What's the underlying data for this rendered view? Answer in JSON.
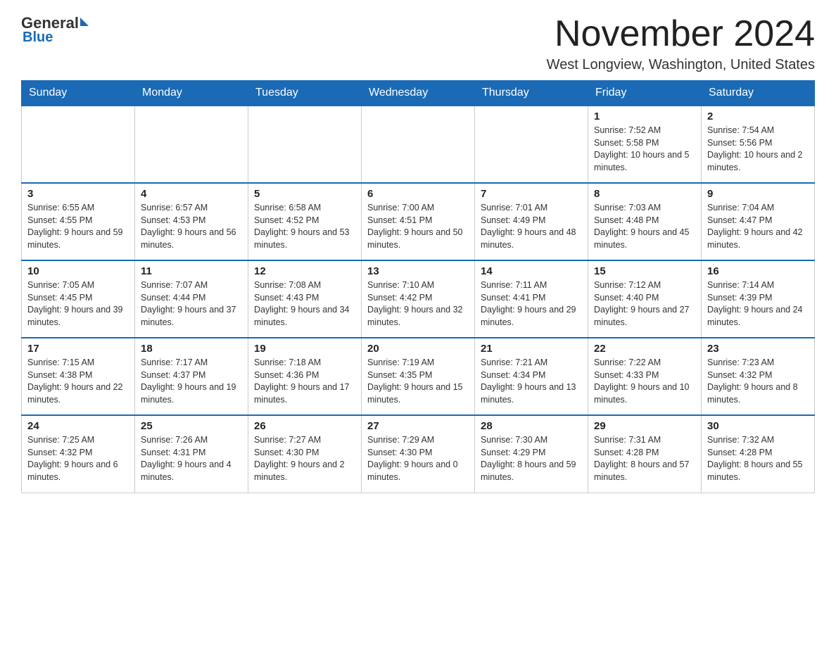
{
  "logo": {
    "general": "General",
    "blue": "Blue"
  },
  "title": {
    "month_year": "November 2024",
    "location": "West Longview, Washington, United States"
  },
  "weekdays": [
    "Sunday",
    "Monday",
    "Tuesday",
    "Wednesday",
    "Thursday",
    "Friday",
    "Saturday"
  ],
  "weeks": [
    [
      {
        "day": "",
        "info": ""
      },
      {
        "day": "",
        "info": ""
      },
      {
        "day": "",
        "info": ""
      },
      {
        "day": "",
        "info": ""
      },
      {
        "day": "",
        "info": ""
      },
      {
        "day": "1",
        "info": "Sunrise: 7:52 AM\nSunset: 5:58 PM\nDaylight: 10 hours and 5 minutes."
      },
      {
        "day": "2",
        "info": "Sunrise: 7:54 AM\nSunset: 5:56 PM\nDaylight: 10 hours and 2 minutes."
      }
    ],
    [
      {
        "day": "3",
        "info": "Sunrise: 6:55 AM\nSunset: 4:55 PM\nDaylight: 9 hours and 59 minutes."
      },
      {
        "day": "4",
        "info": "Sunrise: 6:57 AM\nSunset: 4:53 PM\nDaylight: 9 hours and 56 minutes."
      },
      {
        "day": "5",
        "info": "Sunrise: 6:58 AM\nSunset: 4:52 PM\nDaylight: 9 hours and 53 minutes."
      },
      {
        "day": "6",
        "info": "Sunrise: 7:00 AM\nSunset: 4:51 PM\nDaylight: 9 hours and 50 minutes."
      },
      {
        "day": "7",
        "info": "Sunrise: 7:01 AM\nSunset: 4:49 PM\nDaylight: 9 hours and 48 minutes."
      },
      {
        "day": "8",
        "info": "Sunrise: 7:03 AM\nSunset: 4:48 PM\nDaylight: 9 hours and 45 minutes."
      },
      {
        "day": "9",
        "info": "Sunrise: 7:04 AM\nSunset: 4:47 PM\nDaylight: 9 hours and 42 minutes."
      }
    ],
    [
      {
        "day": "10",
        "info": "Sunrise: 7:05 AM\nSunset: 4:45 PM\nDaylight: 9 hours and 39 minutes."
      },
      {
        "day": "11",
        "info": "Sunrise: 7:07 AM\nSunset: 4:44 PM\nDaylight: 9 hours and 37 minutes."
      },
      {
        "day": "12",
        "info": "Sunrise: 7:08 AM\nSunset: 4:43 PM\nDaylight: 9 hours and 34 minutes."
      },
      {
        "day": "13",
        "info": "Sunrise: 7:10 AM\nSunset: 4:42 PM\nDaylight: 9 hours and 32 minutes."
      },
      {
        "day": "14",
        "info": "Sunrise: 7:11 AM\nSunset: 4:41 PM\nDaylight: 9 hours and 29 minutes."
      },
      {
        "day": "15",
        "info": "Sunrise: 7:12 AM\nSunset: 4:40 PM\nDaylight: 9 hours and 27 minutes."
      },
      {
        "day": "16",
        "info": "Sunrise: 7:14 AM\nSunset: 4:39 PM\nDaylight: 9 hours and 24 minutes."
      }
    ],
    [
      {
        "day": "17",
        "info": "Sunrise: 7:15 AM\nSunset: 4:38 PM\nDaylight: 9 hours and 22 minutes."
      },
      {
        "day": "18",
        "info": "Sunrise: 7:17 AM\nSunset: 4:37 PM\nDaylight: 9 hours and 19 minutes."
      },
      {
        "day": "19",
        "info": "Sunrise: 7:18 AM\nSunset: 4:36 PM\nDaylight: 9 hours and 17 minutes."
      },
      {
        "day": "20",
        "info": "Sunrise: 7:19 AM\nSunset: 4:35 PM\nDaylight: 9 hours and 15 minutes."
      },
      {
        "day": "21",
        "info": "Sunrise: 7:21 AM\nSunset: 4:34 PM\nDaylight: 9 hours and 13 minutes."
      },
      {
        "day": "22",
        "info": "Sunrise: 7:22 AM\nSunset: 4:33 PM\nDaylight: 9 hours and 10 minutes."
      },
      {
        "day": "23",
        "info": "Sunrise: 7:23 AM\nSunset: 4:32 PM\nDaylight: 9 hours and 8 minutes."
      }
    ],
    [
      {
        "day": "24",
        "info": "Sunrise: 7:25 AM\nSunset: 4:32 PM\nDaylight: 9 hours and 6 minutes."
      },
      {
        "day": "25",
        "info": "Sunrise: 7:26 AM\nSunset: 4:31 PM\nDaylight: 9 hours and 4 minutes."
      },
      {
        "day": "26",
        "info": "Sunrise: 7:27 AM\nSunset: 4:30 PM\nDaylight: 9 hours and 2 minutes."
      },
      {
        "day": "27",
        "info": "Sunrise: 7:29 AM\nSunset: 4:30 PM\nDaylight: 9 hours and 0 minutes."
      },
      {
        "day": "28",
        "info": "Sunrise: 7:30 AM\nSunset: 4:29 PM\nDaylight: 8 hours and 59 minutes."
      },
      {
        "day": "29",
        "info": "Sunrise: 7:31 AM\nSunset: 4:28 PM\nDaylight: 8 hours and 57 minutes."
      },
      {
        "day": "30",
        "info": "Sunrise: 7:32 AM\nSunset: 4:28 PM\nDaylight: 8 hours and 55 minutes."
      }
    ]
  ]
}
